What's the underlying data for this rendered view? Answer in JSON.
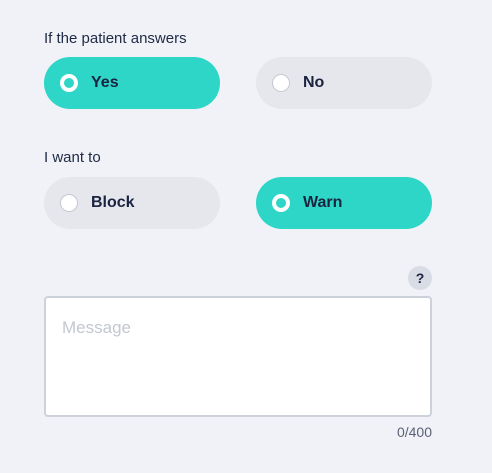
{
  "question1": {
    "label": "If the patient answers",
    "options": [
      {
        "label": "Yes",
        "selected": true
      },
      {
        "label": "No",
        "selected": false
      }
    ]
  },
  "question2": {
    "label": "I want to",
    "options": [
      {
        "label": "Block",
        "selected": false
      },
      {
        "label": "Warn",
        "selected": true
      }
    ]
  },
  "help": {
    "icon": "help-icon",
    "glyph": "?"
  },
  "message": {
    "value": "",
    "placeholder": "Message",
    "counter": "0/400"
  },
  "colors": {
    "accent": "#2dd6c6",
    "background": "#f0f2f7",
    "pill_unselected": "#e5e7ec",
    "text": "#1a2340"
  }
}
